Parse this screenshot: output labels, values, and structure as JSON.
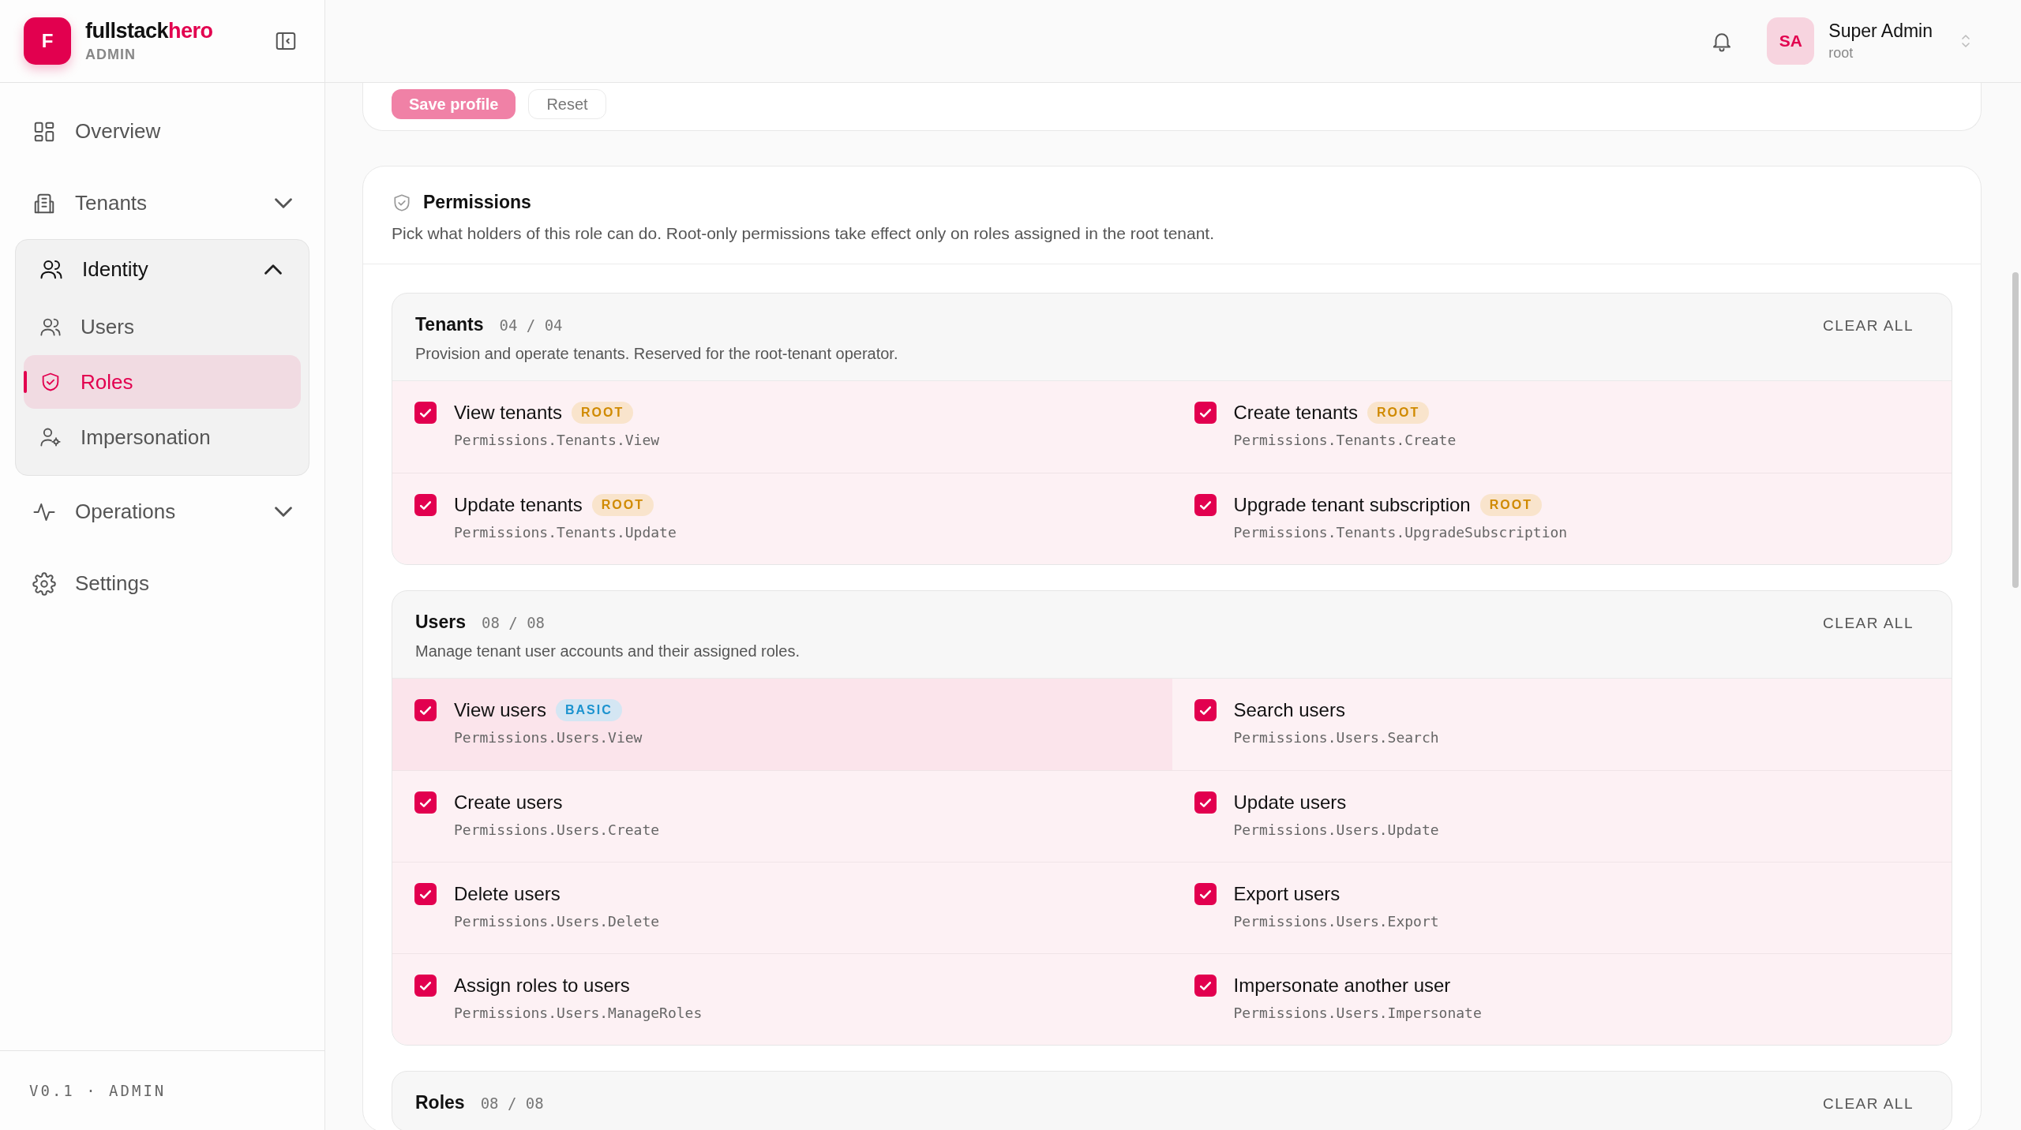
{
  "brand": {
    "logo_letter": "F",
    "name": "fullstack",
    "name_accent": "hero",
    "subtitle": "ADMIN"
  },
  "sidebar": {
    "items": [
      {
        "label": "Overview",
        "selected": false
      },
      {
        "label": "Tenants",
        "selected": false,
        "expanded": false
      },
      {
        "label": "Identity",
        "selected": false,
        "expanded": true,
        "children": [
          {
            "label": "Users",
            "selected": false
          },
          {
            "label": "Roles",
            "selected": true
          },
          {
            "label": "Impersonation",
            "selected": false
          }
        ]
      },
      {
        "label": "Operations",
        "selected": false,
        "expanded": false
      },
      {
        "label": "Settings",
        "selected": false
      }
    ],
    "footer": "V0.1 · ADMIN"
  },
  "header": {
    "user": {
      "initials": "SA",
      "name": "Super Admin",
      "tenant": "root"
    }
  },
  "profile_actions": [
    {
      "label": "Save profile",
      "kind": "primary"
    },
    {
      "label": "Reset",
      "kind": "secondary"
    }
  ],
  "permissions": {
    "title": "Permissions",
    "description": "Pick what holders of this role can do. Root-only permissions take effect only on roles assigned in the root tenant.",
    "groups": [
      {
        "title": "Tenants",
        "count": "04 / 04",
        "description": "Provision and operate tenants. Reserved for the root-tenant operator.",
        "action": "CLEAR ALL",
        "items": [
          {
            "label": "View tenants",
            "badge": {
              "text": "ROOT",
              "kind": "root"
            },
            "code": "Permissions.Tenants.View",
            "checked": true,
            "hovered": false
          },
          {
            "label": "Create tenants",
            "badge": {
              "text": "ROOT",
              "kind": "root"
            },
            "code": "Permissions.Tenants.Create",
            "checked": true,
            "hovered": false
          },
          {
            "label": "Update tenants",
            "badge": {
              "text": "ROOT",
              "kind": "root"
            },
            "code": "Permissions.Tenants.Update",
            "checked": true,
            "hovered": false
          },
          {
            "label": "Upgrade tenant subscription",
            "badge": {
              "text": "ROOT",
              "kind": "root"
            },
            "code": "Permissions.Tenants.UpgradeSubscription",
            "checked": true,
            "hovered": false
          }
        ]
      },
      {
        "title": "Users",
        "count": "08 / 08",
        "description": "Manage tenant user accounts and their assigned roles.",
        "action": "CLEAR ALL",
        "items": [
          {
            "label": "View users",
            "badge": {
              "text": "BASIC",
              "kind": "basic"
            },
            "code": "Permissions.Users.View",
            "checked": true,
            "hovered": true
          },
          {
            "label": "Search users",
            "code": "Permissions.Users.Search",
            "checked": true,
            "hovered": false
          },
          {
            "label": "Create users",
            "code": "Permissions.Users.Create",
            "checked": true,
            "hovered": false
          },
          {
            "label": "Update users",
            "code": "Permissions.Users.Update",
            "checked": true,
            "hovered": false
          },
          {
            "label": "Delete users",
            "code": "Permissions.Users.Delete",
            "checked": true,
            "hovered": false
          },
          {
            "label": "Export users",
            "code": "Permissions.Users.Export",
            "checked": true,
            "hovered": false
          },
          {
            "label": "Assign roles to users",
            "code": "Permissions.Users.ManageRoles",
            "checked": true,
            "hovered": false
          },
          {
            "label": "Impersonate another user",
            "code": "Permissions.Users.Impersonate",
            "checked": true,
            "hovered": false
          }
        ]
      },
      {
        "title": "Roles",
        "count": "08 / 08",
        "action": "CLEAR ALL"
      }
    ]
  }
}
